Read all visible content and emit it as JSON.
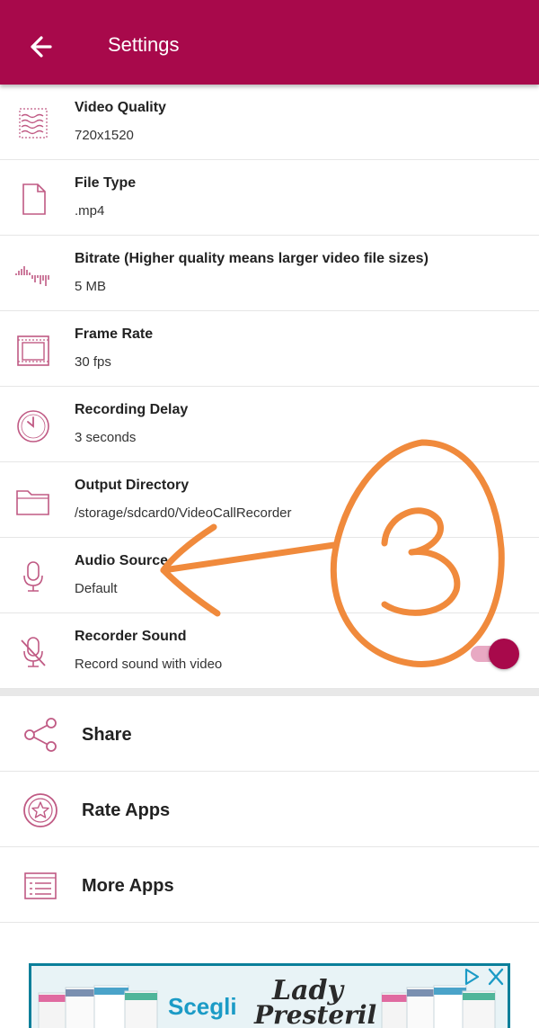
{
  "appbar": {
    "title": "Settings",
    "back_icon": "arrow-left-icon",
    "color": "#a8094b"
  },
  "settings": [
    {
      "label": "Video Quality",
      "value": "720x1520",
      "icon": "video-quality-icon"
    },
    {
      "label": "File Type",
      "value": ".mp4",
      "icon": "file-icon"
    },
    {
      "label": "Bitrate (Higher quality means larger video file sizes)",
      "value": "5 MB",
      "icon": "waveform-icon"
    },
    {
      "label": "Frame Rate",
      "value": "30 fps",
      "icon": "film-frame-icon"
    },
    {
      "label": "Recording Delay",
      "value": "3 seconds",
      "icon": "clock-icon"
    },
    {
      "label": "Output Directory",
      "value": "/storage/sdcard0/VideoCallRecorder",
      "icon": "folder-icon"
    },
    {
      "label": "Audio Source",
      "value": "Default",
      "icon": "microphone-icon"
    },
    {
      "label": "Recorder Sound",
      "value": "Record sound with video",
      "icon": "mic-off-icon",
      "toggle_on": true
    }
  ],
  "actions": [
    {
      "label": "Share",
      "icon": "share-icon"
    },
    {
      "label": "Rate Apps",
      "icon": "star-badge-icon"
    },
    {
      "label": "More Apps",
      "icon": "list-icon"
    }
  ],
  "ad": {
    "text_1": "Scegli",
    "brand_line_1": "Lady",
    "brand_line_2": "Presteril",
    "adchoice_icon": "adchoices-icon",
    "close_icon": "close-icon"
  },
  "annotation": {
    "text": "3",
    "color": "#f08a3c"
  }
}
